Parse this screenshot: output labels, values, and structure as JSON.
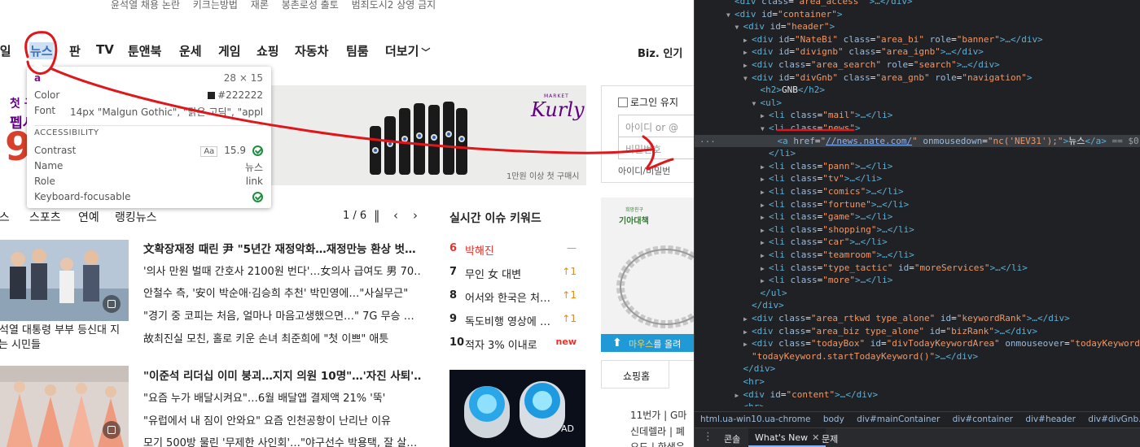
{
  "page": {
    "trending": [
      "윤석열 채용 논란",
      "키크는방법",
      "재론",
      "봉촌로성 출토",
      "범죄도시2 상영 금지"
    ],
    "gnb": {
      "items": [
        {
          "label": "메일",
          "active": false
        },
        {
          "label": "뉴스",
          "active": true
        },
        {
          "label": "판",
          "active": false
        },
        {
          "label": "TV",
          "active": false
        },
        {
          "label": "툰앤북",
          "active": false
        },
        {
          "label": "운세",
          "active": false
        },
        {
          "label": "게임",
          "active": false
        },
        {
          "label": "쇼핑",
          "active": false
        },
        {
          "label": "자동차",
          "active": false
        },
        {
          "label": "팀룸",
          "active": false
        },
        {
          "label": "더보기",
          "active": false
        }
      ],
      "biz": "Biz. 인기"
    },
    "banner": {
      "promo_line1": "첫 구",
      "promo_line2": "펩시",
      "promo_big": "9",
      "kurly_small": "MARKET",
      "kurly": "Kurly",
      "price_note": "1만원 이상 첫 구매시"
    },
    "login": {
      "keep_label": "로그인 유지",
      "id_placeholder": "아이디 or @",
      "pw_placeholder": "비밀번호",
      "find": "아이디/비밀번"
    },
    "news_tabs": {
      "tabs": [
        "뉴스",
        "스포츠",
        "연예",
        "랭킹뉴스"
      ],
      "pager": "1 / 6"
    },
    "news_block1": {
      "caption": [
        "尹석열 대통령 부부 등신대 지",
        "나는 시민들"
      ],
      "lines": [
        {
          "text": "文확장재정 때린 尹 \"5년간 재정악화…재정만능 환상 벗…",
          "head": true
        },
        {
          "text": "'의사 만원 벌때 간호사 2100원 번다'…女의사 급여도 男 70…",
          "head": false
        },
        {
          "text": "안철수 측, '安이 박순애·김승희 추천' 박민영에…\"사실무근\"",
          "head": false
        },
        {
          "text": "\"경기 중 코피는 처음, 얼마나 마음고생했으면…\" 7G 무승 …",
          "head": false
        },
        {
          "text": "故최진실 모친, 홀로 키운 손녀 최준희에 \"첫 이쁘\" 애틋",
          "head": false
        }
      ]
    },
    "news_block2": {
      "lines": [
        {
          "text": "\"이준석 리더십 이미 붕괴…지지 의원 10명\"…'자진 사퇴'…",
          "head": true
        },
        {
          "text": "\"요즘 누가 배달시켜요\"…6월 배달앱 결제액 21% '뚝'",
          "head": false
        },
        {
          "text": "\"유럽에서 내 짐이 안와요\" 요즘 인천공항이 난리난 이유",
          "head": false
        },
        {
          "text": "모기 500방 물린 '무제한 사인회'…\"야구선수 박용택, 잘 살…",
          "head": false
        }
      ]
    },
    "keywords": {
      "title": "실시간 이슈 키워드",
      "rows": [
        {
          "rank": "6",
          "keyword": "박해진",
          "change": "—",
          "kind": "same",
          "color": "#e8312a"
        },
        {
          "rank": "7",
          "keyword": "무인 女 대변",
          "change": "↑1",
          "kind": "up",
          "color": "#222222"
        },
        {
          "rank": "8",
          "keyword": "어서와 한국은 처…",
          "change": "↑1",
          "kind": "up",
          "color": "#222222"
        },
        {
          "rank": "9",
          "keyword": "독도비행 영상에 …",
          "change": "↑1",
          "kind": "up",
          "color": "#222222"
        },
        {
          "rank": "10",
          "keyword": "적자 3% 이내로",
          "change": "new",
          "kind": "new",
          "color": "#222222"
        }
      ]
    },
    "ad_fan": {
      "label": "AD"
    },
    "ad_side": {
      "logo_small": "희망친구",
      "logo": "기아대책",
      "foot_highlight": "마우스",
      "foot_rest": "를 올려"
    },
    "shopping": {
      "tab": "쇼핑홈",
      "lines": [
        "11번가 | G마",
        "신데렐라 | 폐",
        "오드 | 한샘은"
      ]
    },
    "tooltip": {
      "tag": "a",
      "size": "28 × 15",
      "color_label": "Color",
      "color_value": "#222222",
      "font_label": "Font",
      "font_value": "14px \"Malgun Gothic\", \"맑은 고딕\", \"appl…",
      "accessibility_header": "ACCESSIBILITY",
      "contrast_label": "Contrast",
      "contrast_aa": "Aa",
      "contrast_value": "15.9",
      "name_label": "Name",
      "name_value": "뉴스",
      "role_label": "Role",
      "role_value": "link",
      "kf_label": "Keyboard-focusable"
    }
  },
  "devtools": {
    "dom_rows": [
      {
        "indent": 2,
        "tw": "",
        "html": "<span class=\"t\">&lt;div</span> <span class=\"an\">class</span>=<span class=\"av\">\"area_access\"</span> <span class=\"t\">&gt;…&lt;/div&gt;</span>"
      },
      {
        "indent": 2,
        "tw": "▼",
        "html": "<span class=\"t\">&lt;div</span> <span class=\"an\">id</span>=<span class=\"av\">\"container\"</span><span class=\"t\">&gt;</span>"
      },
      {
        "indent": 3,
        "tw": "▼",
        "html": "<span class=\"t\">&lt;div</span> <span class=\"an\">id</span>=<span class=\"av\">\"header\"</span><span class=\"t\">&gt;</span>"
      },
      {
        "indent": 4,
        "tw": "▶",
        "html": "<span class=\"t\">&lt;div</span> <span class=\"an\">id</span>=<span class=\"av\">\"NateBi\"</span> <span class=\"an\">class</span>=<span class=\"av\">\"area_bi\"</span> <span class=\"an\">role</span>=<span class=\"av\">\"banner\"</span><span class=\"t\">&gt;…&lt;/div&gt;</span>"
      },
      {
        "indent": 4,
        "tw": "▶",
        "html": "<span class=\"t\">&lt;div</span> <span class=\"an\">id</span>=<span class=\"av\">\"divignb\"</span> <span class=\"an\">class</span>=<span class=\"av\">\"area_ignb\"</span><span class=\"t\">&gt;…&lt;/div&gt;</span>"
      },
      {
        "indent": 4,
        "tw": "▶",
        "html": "<span class=\"t\">&lt;div</span> <span class=\"an\">class</span>=<span class=\"av\">\"area_search\"</span> <span class=\"an\">role</span>=<span class=\"av\">\"search\"</span><span class=\"t\">&gt;…&lt;/div&gt;</span>"
      },
      {
        "indent": 4,
        "tw": "▼",
        "html": "<span class=\"t\">&lt;div</span> <span class=\"an\">id</span>=<span class=\"av\">\"divGnb\"</span> <span class=\"an\">class</span>=<span class=\"av\">\"area_gnb\"</span> <span class=\"an\">role</span>=<span class=\"av\">\"navigation\"</span><span class=\"t\">&gt;</span>"
      },
      {
        "indent": 5,
        "tw": "",
        "html": "<span class=\"t\">&lt;h2&gt;</span><span class=\"tx\">GNB</span><span class=\"t\">&lt;/h2&gt;</span>"
      },
      {
        "indent": 5,
        "tw": "▼",
        "html": "<span class=\"t\">&lt;ul&gt;</span>"
      },
      {
        "indent": 6,
        "tw": "▶",
        "html": "<span class=\"t\">&lt;li</span> <span class=\"an\">class</span>=<span class=\"av\">\"mail\"</span><span class=\"t\">&gt;…&lt;/li&gt;</span>"
      },
      {
        "indent": 6,
        "tw": "▼",
        "html": "<span class=\"t\">&lt;li</span> <span class=\"an\">class</span>=<span class=\"av\">\"news\"</span><span class=\"t\">&gt;</span>"
      },
      {
        "indent": 7,
        "tw": "",
        "sel": true,
        "html": "<span class=\"t\">&lt;a</span> <span class=\"an\">href</span>=<span class=\"av\">\"<span class=\"lk\">//news.nate.com/</span>\"</span> <span class=\"an\">onmousedown</span>=<span class=\"av\">\"nc('NEV31');\"</span><span class=\"t\">&gt;</span><span class=\"tx\">뉴스</span><span class=\"t\">&lt;/a&gt;</span> <span class=\"eq\">== $0</span>"
      },
      {
        "indent": 6,
        "tw": "",
        "html": "<span class=\"t\">&lt;/li&gt;</span>"
      },
      {
        "indent": 6,
        "tw": "▶",
        "html": "<span class=\"t\">&lt;li</span> <span class=\"an\">class</span>=<span class=\"av\">\"pann\"</span><span class=\"t\">&gt;…&lt;/li&gt;</span>"
      },
      {
        "indent": 6,
        "tw": "▶",
        "html": "<span class=\"t\">&lt;li</span> <span class=\"an\">class</span>=<span class=\"av\">\"tv\"</span><span class=\"t\">&gt;…&lt;/li&gt;</span>"
      },
      {
        "indent": 6,
        "tw": "▶",
        "html": "<span class=\"t\">&lt;li</span> <span class=\"an\">class</span>=<span class=\"av\">\"comics\"</span><span class=\"t\">&gt;…&lt;/li&gt;</span>"
      },
      {
        "indent": 6,
        "tw": "▶",
        "html": "<span class=\"t\">&lt;li</span> <span class=\"an\">class</span>=<span class=\"av\">\"fortune\"</span><span class=\"t\">&gt;…&lt;/li&gt;</span>"
      },
      {
        "indent": 6,
        "tw": "▶",
        "html": "<span class=\"t\">&lt;li</span> <span class=\"an\">class</span>=<span class=\"av\">\"game\"</span><span class=\"t\">&gt;…&lt;/li&gt;</span>"
      },
      {
        "indent": 6,
        "tw": "▶",
        "html": "<span class=\"t\">&lt;li</span> <span class=\"an\">class</span>=<span class=\"av\">\"shopping\"</span><span class=\"t\">&gt;…&lt;/li&gt;</span>"
      },
      {
        "indent": 6,
        "tw": "▶",
        "html": "<span class=\"t\">&lt;li</span> <span class=\"an\">class</span>=<span class=\"av\">\"car\"</span><span class=\"t\">&gt;…&lt;/li&gt;</span>"
      },
      {
        "indent": 6,
        "tw": "▶",
        "html": "<span class=\"t\">&lt;li</span> <span class=\"an\">class</span>=<span class=\"av\">\"teamroom\"</span><span class=\"t\">&gt;…&lt;/li&gt;</span>"
      },
      {
        "indent": 6,
        "tw": "▶",
        "html": "<span class=\"t\">&lt;li</span> <span class=\"an\">class</span>=<span class=\"av\">\"type_tactic\"</span> <span class=\"an\">id</span>=<span class=\"av\">\"moreServices\"</span><span class=\"t\">&gt;…&lt;/li&gt;</span>"
      },
      {
        "indent": 6,
        "tw": "▶",
        "html": "<span class=\"t\">&lt;li</span> <span class=\"an\">class</span>=<span class=\"av\">\"more\"</span><span class=\"t\">&gt;…&lt;/li&gt;</span>"
      },
      {
        "indent": 5,
        "tw": "",
        "html": "<span class=\"t\">&lt;/ul&gt;</span>"
      },
      {
        "indent": 4,
        "tw": "",
        "html": "<span class=\"t\">&lt;/div&gt;</span>"
      },
      {
        "indent": 4,
        "tw": "▶",
        "html": "<span class=\"t\">&lt;div</span> <span class=\"an\">class</span>=<span class=\"av\">\"area_rtkwd type_alone\"</span> <span class=\"an\">id</span>=<span class=\"av\">\"keywordRank\"</span><span class=\"t\">&gt;…&lt;/div&gt;</span>"
      },
      {
        "indent": 4,
        "tw": "▶",
        "html": "<span class=\"t\">&lt;div</span> <span class=\"an\">class</span>=<span class=\"av\">\"area_biz type_alone\"</span> <span class=\"an\">id</span>=<span class=\"av\">\"bizRank\"</span><span class=\"t\">&gt;…&lt;/div&gt;</span>"
      },
      {
        "indent": 4,
        "tw": "▶",
        "html": "<span class=\"t\">&lt;div</span> <span class=\"an\">class</span>=<span class=\"av\">\"todayBox\"</span> <span class=\"an\">id</span>=<span class=\"av\">\"divTodayKeywordArea\"</span> <span class=\"an\">onmouseover</span>=<span class=\"av\">\"todayKeyword.stopToda</span>"
      },
      {
        "indent": 4,
        "tw": "",
        "html": "<span class=\"av\">\"todayKeyword.startTodayKeyword()\"</span><span class=\"t\">&gt;…&lt;/div&gt;</span>"
      },
      {
        "indent": 3,
        "tw": "",
        "html": "<span class=\"t\">&lt;/div&gt;</span>"
      },
      {
        "indent": 3,
        "tw": "",
        "html": "<span class=\"t\">&lt;hr&gt;</span>"
      },
      {
        "indent": 3,
        "tw": "▶",
        "html": "<span class=\"t\">&lt;div</span> <span class=\"an\">id</span>=<span class=\"av\">\"content\"</span><span class=\"t\">&gt;…&lt;/div&gt;</span>"
      },
      {
        "indent": 3,
        "tw": "",
        "html": "<span class=\"t\">&lt;hr&gt;</span>"
      }
    ],
    "breadcrumbs": [
      "html.ua-win10.ua-chrome",
      "body",
      "div#mainContainer",
      "div#container",
      "div#header",
      "div#divGnb.area_gnb",
      "ul"
    ],
    "drawer": {
      "tabs": [
        {
          "label": "콘솔",
          "active": false,
          "closable": false
        },
        {
          "label": "What's New",
          "active": true,
          "closable": true
        },
        {
          "label": "문제",
          "active": false,
          "closable": false
        }
      ]
    }
  },
  "colors": {
    "annotation": "#e0161b",
    "active_nav_bg": "#6fa8dc",
    "devtools_bg": "#202124"
  }
}
